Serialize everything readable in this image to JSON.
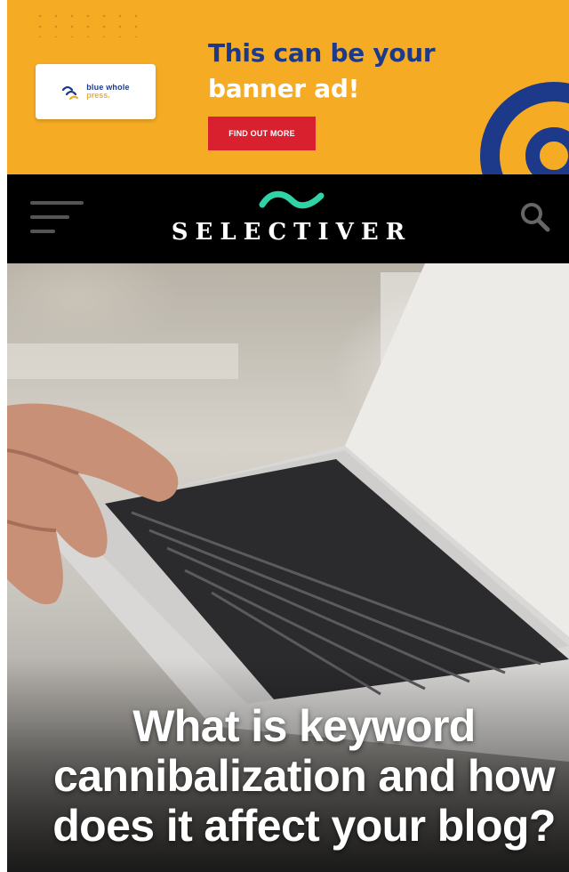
{
  "banner": {
    "logo": {
      "line1": "blue whole",
      "line2": "press."
    },
    "headline_line1": "This can be your",
    "headline_line2": "banner ad!",
    "cta_label": "FIND OUT MORE",
    "colors": {
      "background": "#f5ac24",
      "headline_blue": "#1d3a8a",
      "cta_red": "#d8202e"
    }
  },
  "header": {
    "menu_icon": "hamburger-menu-icon",
    "logo_icon": "wave-icon",
    "site_name": "SELECTIVER",
    "search_icon": "search-icon",
    "colors": {
      "background": "#000000",
      "wave": "#2fd3a6"
    }
  },
  "hero": {
    "title": "What is keyword\ncannibalization and how\ndoes it affect your blog?"
  }
}
